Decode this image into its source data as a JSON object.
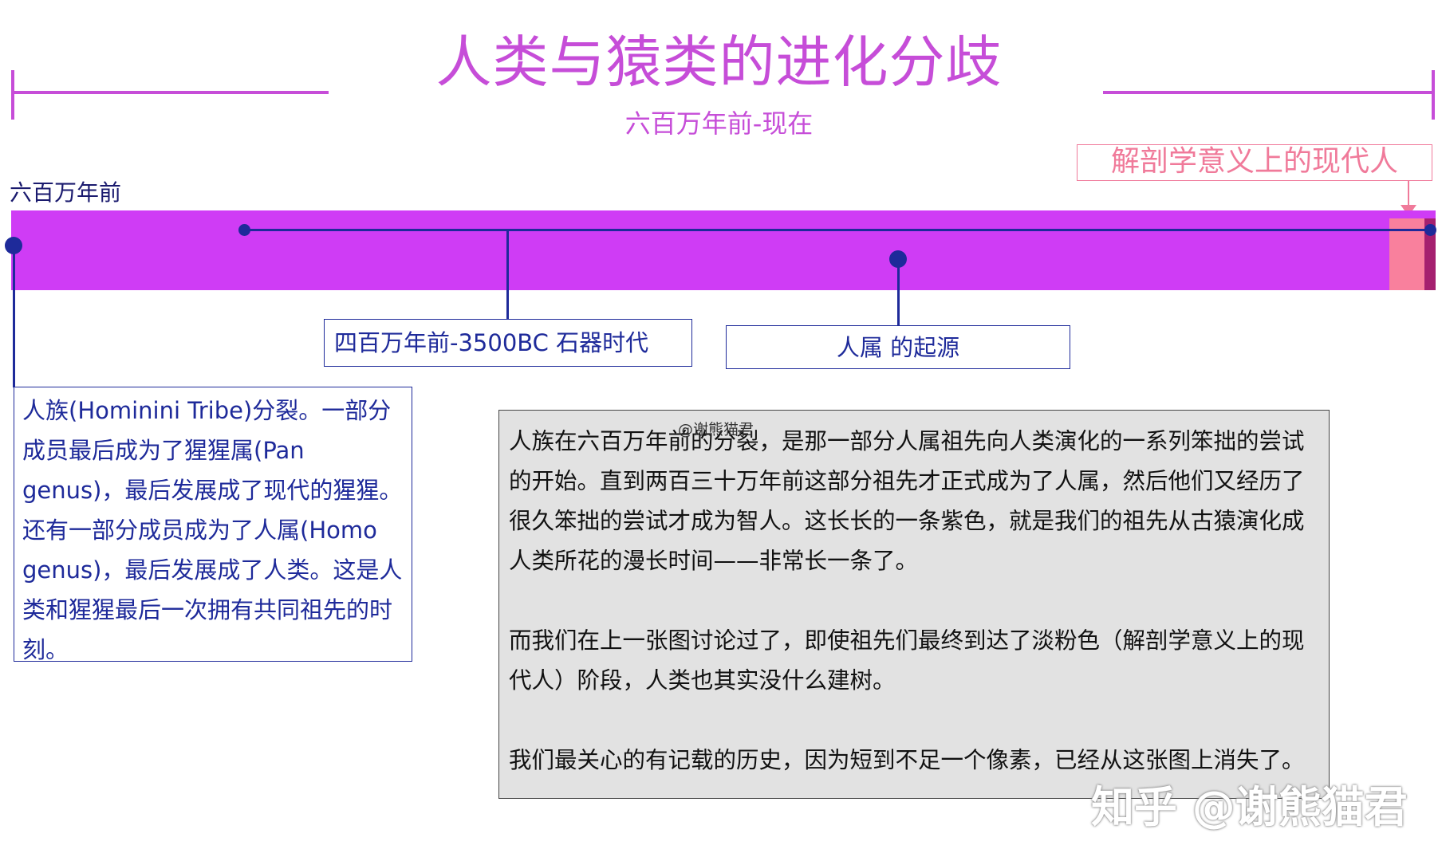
{
  "header": {
    "title": "人类与猿类的进化分歧",
    "subtitle": "六百万年前-现在"
  },
  "timeline": {
    "start_label": "六百万年前",
    "colors": {
      "hominin_period": "#cf3cf5",
      "modern_human_period": "#f9809d",
      "recorded_history": "#a5206f",
      "marker": "#1e2a9a",
      "heading": "#c64dd8"
    }
  },
  "labels": {
    "modern_human": "解剖学意义上的现代人",
    "stone_age": "四百万年前-3500BC 石器时代",
    "genus_origin": "人属 的起源",
    "split_lines": [
      "人族(Hominini Tribe)分裂。一部分",
      "成员最后成为了猩猩属(Pan",
      "genus)，最后发展成了现代的猩猩。",
      "还有一部分成员成为了人属(Homo",
      "genus)，最后发展成了人类。这是人",
      "类和猩猩最后一次拥有共同祖先的时",
      "刻。"
    ]
  },
  "note": {
    "paragraphs": [
      "人族在六百万年前的分裂，是那一部分人属祖先向人类演化的一系列笨拙的尝试的开始。直到两百三十万年前这部分祖先才正式成为了人属，然后他们又经历了很久笨拙的尝试才成为智人。这长长的一条紫色，就是我们的祖先从古猿演化成人类所花的漫长时间——非常长一条了。",
      "而我们在上一张图讨论过了，即使祖先们最终到达了淡粉色（解剖学意义上的现代人）阶段，人类也其实没什么建树。",
      "我们最关心的有记载的历史，因为短到不足一个像素，已经从这张图上消失了。"
    ],
    "credit": "@谢熊猫君"
  },
  "watermark": "知乎 @谢熊猫君"
}
